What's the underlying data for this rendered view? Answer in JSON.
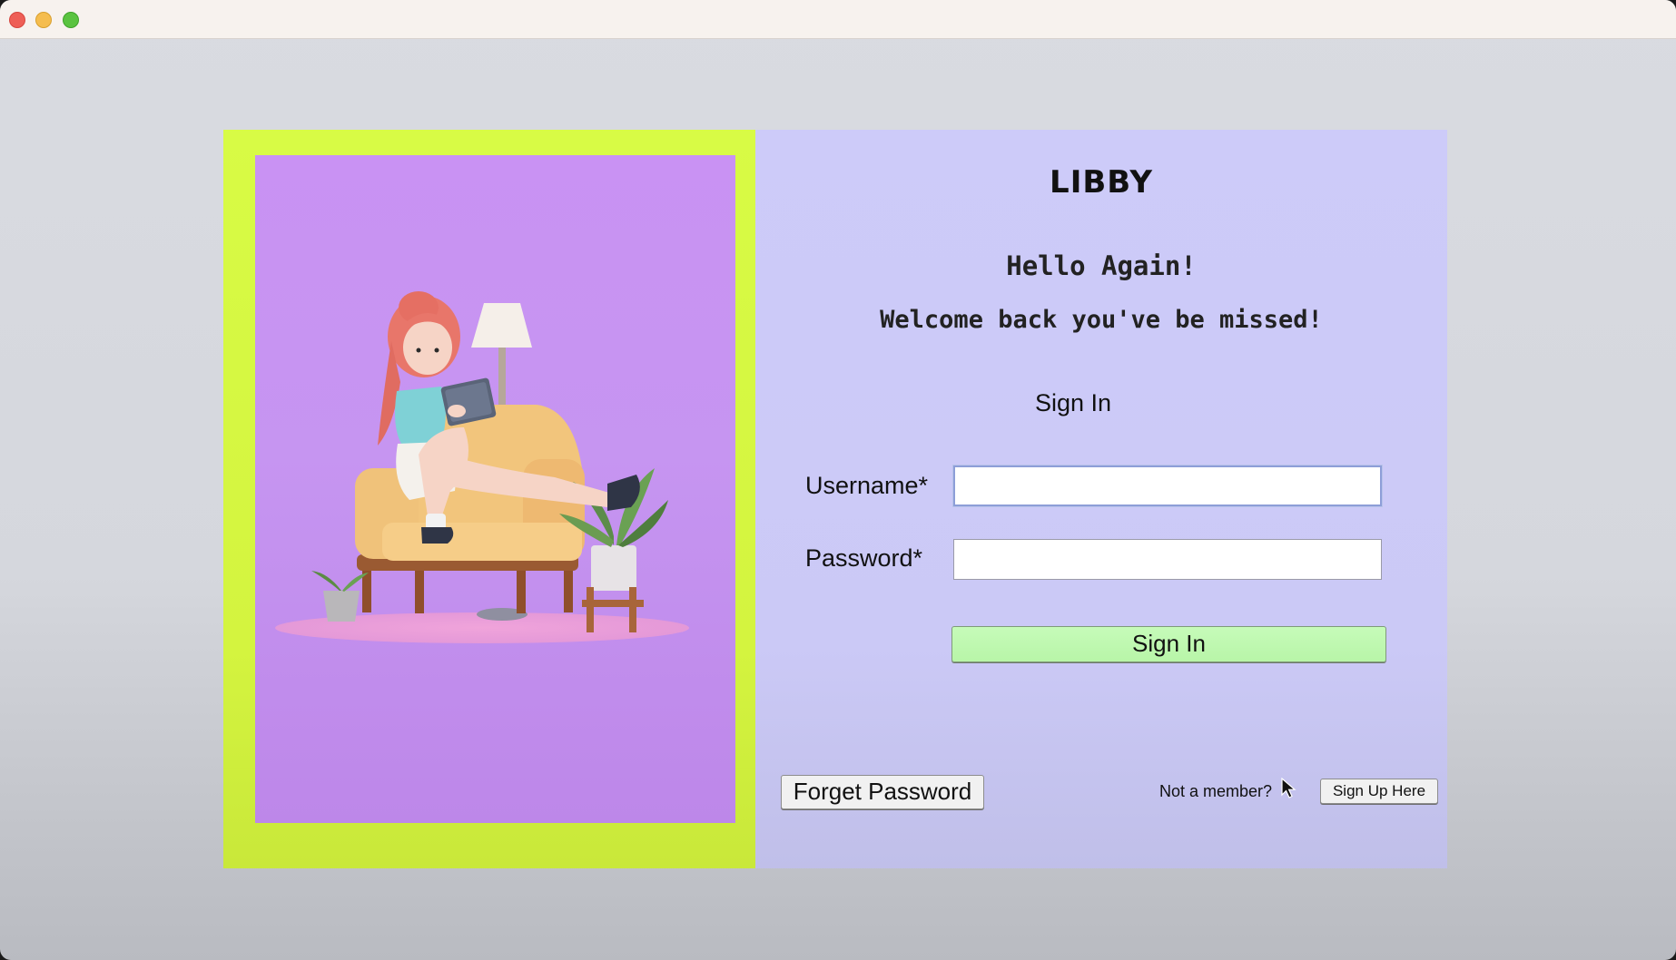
{
  "window": {
    "controls": [
      "close",
      "minimize",
      "zoom"
    ]
  },
  "app": {
    "title": "LIBBY",
    "greeting": "Hello Again!",
    "subtitle": "Welcome back you've be missed!",
    "form_heading": "Sign In"
  },
  "form": {
    "username_label": "Username*",
    "username_value": "",
    "password_label": "Password*",
    "password_value": "",
    "submit_label": "Sign In"
  },
  "footer": {
    "forget_password_label": "Forget Password",
    "not_member_text": "Not a member?",
    "signup_label": "Sign Up Here"
  },
  "hero": {
    "illustration": "girl-reading-tablet-on-armchair"
  },
  "colors": {
    "left_panel": "#d8fb45",
    "hero_bg": "#c992f3",
    "right_panel": "#cdcbf9",
    "signin_button": "#c6fbb9"
  }
}
